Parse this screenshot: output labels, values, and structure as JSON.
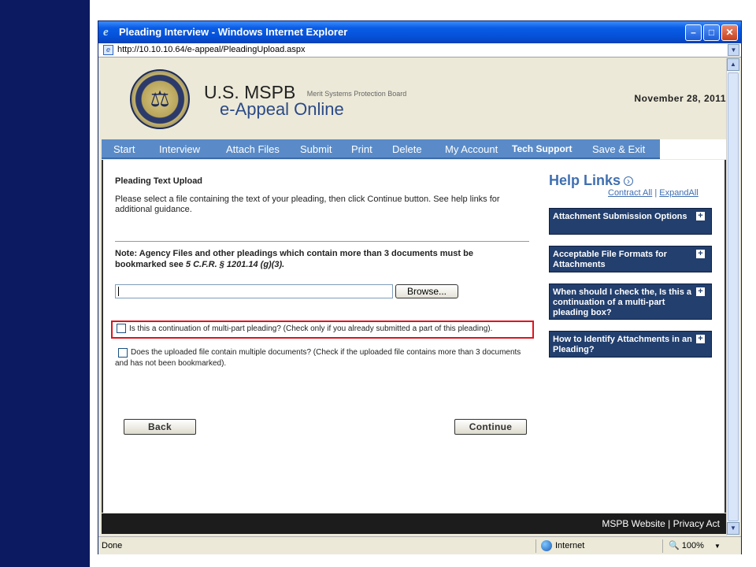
{
  "browser": {
    "window_title": "Pleading Interview - Windows Internet Explorer",
    "url": "http://10.10.10.64/e-appeal/PleadingUpload.aspx",
    "status": "Done",
    "zone": "Internet",
    "zoom": "100%"
  },
  "header": {
    "org_abbr": "U.S. MSPB",
    "org_full": "Merit Systems Protection Board",
    "app_name": "e-Appeal Online",
    "date": "November 28, 2011"
  },
  "nav": {
    "items": [
      "Start",
      "Interview",
      "Attach Files",
      "Submit",
      "Print",
      "Delete",
      "My Account",
      "Tech Support",
      "Save & Exit"
    ]
  },
  "main": {
    "section_title": "Pleading Text Upload",
    "instructions": "Please select a file containing the text of your pleading, then click Continue button. See help links for additional guidance.",
    "note_prefix": "Note: Agency Files and other pleadings which contain more than 3 documents must be bookmarked see",
    "note_citation": "5 C.F.R. § 1201.14 (g)(3).",
    "file_input_value": "",
    "browse_label": "Browse...",
    "checkbox1_label": "Is this a continuation of multi-part pleading? (Check only if you already submitted a part of this pleading).",
    "checkbox1_checked": false,
    "checkbox2_label": "Does the uploaded file contain multiple documents? (Check if the uploaded file contains more than 3 documents and has not been bookmarked).",
    "checkbox2_checked": false,
    "back_label": "Back",
    "continue_label": "Continue"
  },
  "help": {
    "title": "Help Links",
    "contract_all": "Contract All",
    "separator": "|",
    "expand_all": "ExpandAll",
    "items": [
      "Attachment Submission Options",
      "Acceptable File Formats for Attachments",
      "When should I check the, Is this a continuation of a multi-part pleading box?",
      "How to Identify Attachments in an Pleading?"
    ]
  },
  "footer": {
    "website": "MSPB Website",
    "separator": "|",
    "privacy": "Privacy Act"
  },
  "colors": {
    "slide_strip": "#0c1a62",
    "nav_bg": "#5a8bc8",
    "help_box_bg": "#223f6e",
    "highlight_border": "#e0141e",
    "footer_bg": "#1c1c1c"
  }
}
